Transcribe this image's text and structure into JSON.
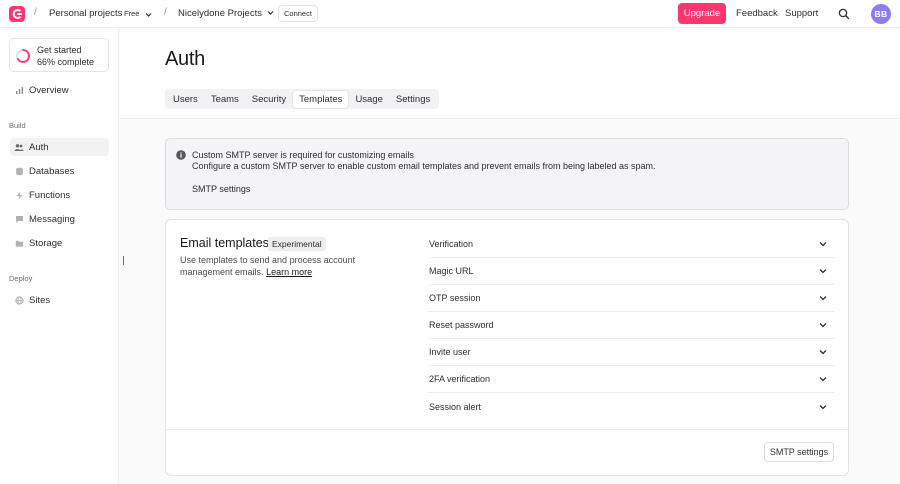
{
  "topbar": {
    "org_name": "Personal projects",
    "org_badge": "Free",
    "project_name": "Nicelydone Projects",
    "connect_label": "Connect",
    "upgrade_label": "Upgrade",
    "feedback_label": "Feedback",
    "support_label": "Support",
    "avatar_initials": "BB",
    "separator": "/"
  },
  "sidebar": {
    "progress": {
      "line1": "Get started",
      "line2": "66% complete",
      "value": 0.66
    },
    "overview_label": "Overview",
    "build_section": "Build",
    "build_items": [
      "Auth",
      "Databases",
      "Functions",
      "Messaging",
      "Storage"
    ],
    "deploy_section": "Deploy",
    "deploy_items": [
      "Sites"
    ],
    "active_item": "Auth"
  },
  "header": {
    "title": "Auth",
    "tabs": [
      "Users",
      "Teams",
      "Security",
      "Templates",
      "Usage",
      "Settings"
    ],
    "active_tab": "Templates"
  },
  "alert": {
    "title": "Custom SMTP server is required for customizing emails",
    "description": "Configure a custom SMTP server to enable custom email templates and prevent emails from being labeled as spam.",
    "link_label": "SMTP settings"
  },
  "email_templates": {
    "title": "Email templates",
    "badge": "Experimental",
    "description": "Use templates to send and process account management emails.",
    "learn_more": "Learn more",
    "items": [
      "Verification",
      "Magic URL",
      "OTP session",
      "Reset password",
      "Invite user",
      "2FA verification",
      "Session alert"
    ],
    "footer_button": "SMTP settings"
  },
  "colors": {
    "brand": "#fd366e",
    "avatar": "#8b7df0",
    "text": "#2d2d31",
    "border": "#e2e2e6"
  }
}
